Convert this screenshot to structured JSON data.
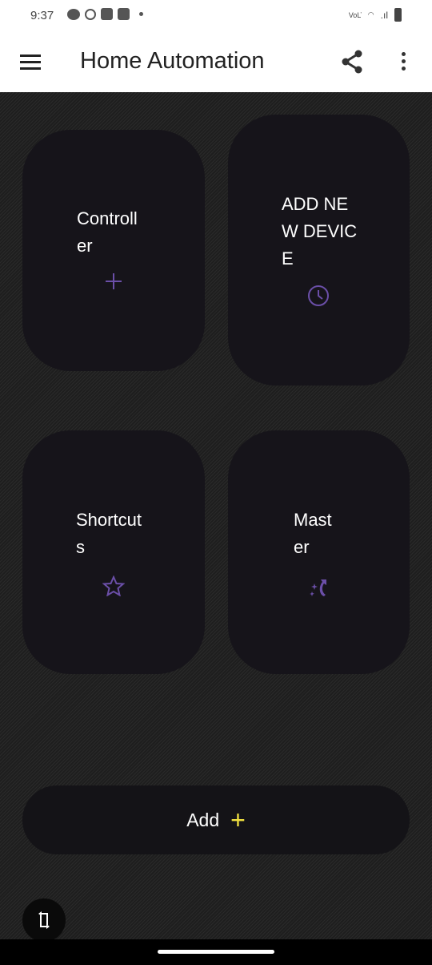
{
  "status_bar": {
    "time": "9:37",
    "network": "VoLTE"
  },
  "app_bar": {
    "title": "Home Automation"
  },
  "cards": [
    {
      "label": "Controller",
      "icon": "plus-icon"
    },
    {
      "label": "ADD NEW DEVICE",
      "icon": "clock-icon"
    },
    {
      "label": "Shortcuts",
      "icon": "star-icon"
    },
    {
      "label": "Master",
      "icon": "magic-icon"
    }
  ],
  "add_button": {
    "label": "Add",
    "icon": "plus-icon"
  },
  "colors": {
    "accent": "#6b4fa8",
    "add_plus": "#f0e040"
  }
}
